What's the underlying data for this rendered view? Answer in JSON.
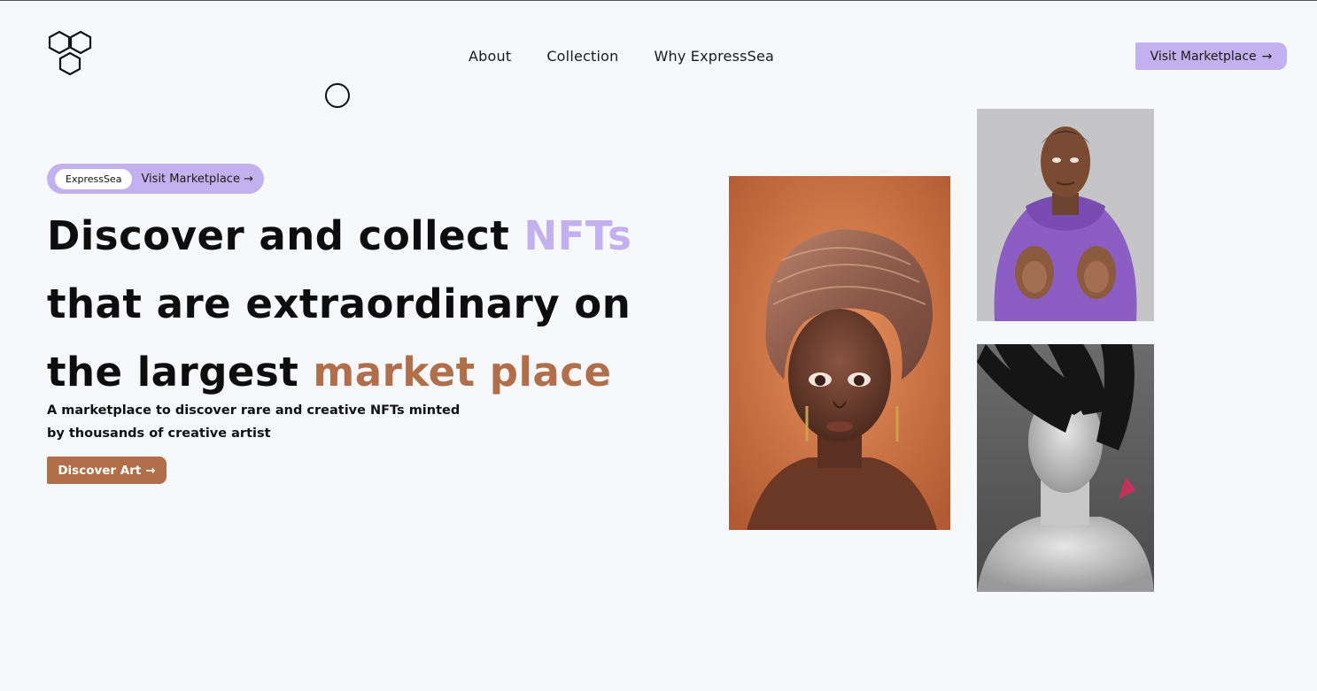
{
  "brand": {
    "logo_icon": "hexagon-logo-icon"
  },
  "nav": {
    "items": [
      {
        "label": "About"
      },
      {
        "label": "Collection"
      },
      {
        "label": "Why ExpressSea"
      }
    ]
  },
  "header_cta": {
    "label": "Visit Marketplace",
    "icon": "arrow-right-icon"
  },
  "hero": {
    "pill": {
      "tag": "ExpressSea",
      "label": "Visit Marketplace",
      "icon": "arrow-right-icon"
    },
    "headline": {
      "part1": "Discover and collect ",
      "highlight1": "NFTs",
      "line2": "that are extraordinary on",
      "part3": "the largest ",
      "highlight2": "market place"
    },
    "subtitle": "A marketplace to discover rare and creative NFTs minted by thousands of creative artist",
    "cta": {
      "label": "Discover Art",
      "icon": "arrow-right-icon"
    }
  },
  "colors": {
    "background": "#f7f8fc",
    "accent_purple": "#c3b0ee",
    "accent_brown": "#b06e4a",
    "text": "#0d0d0d"
  }
}
